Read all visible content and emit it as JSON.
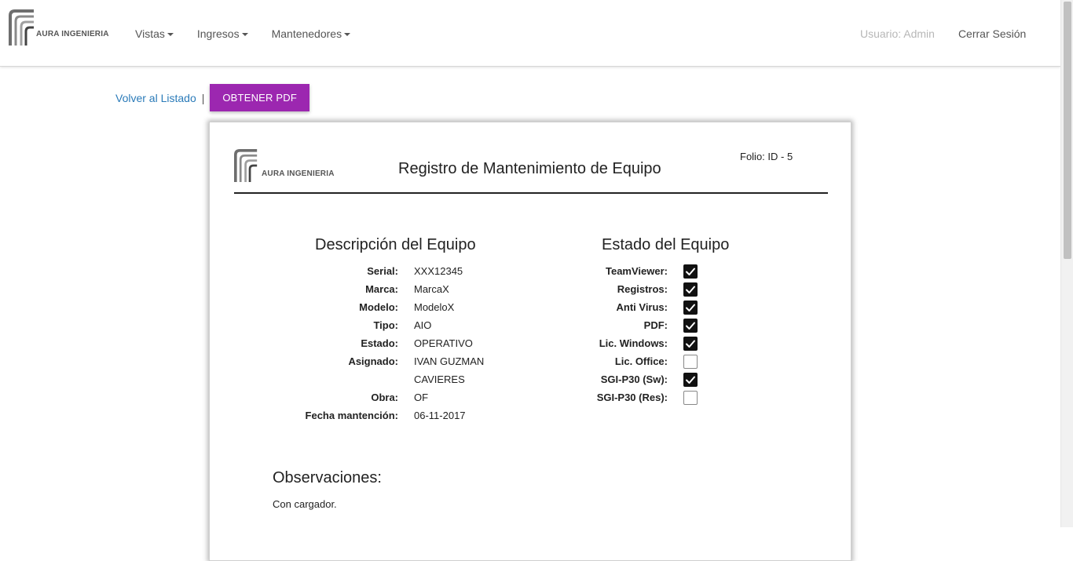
{
  "brand": {
    "name": "AURA INGENIERIA"
  },
  "nav": {
    "items": [
      {
        "label": "Vistas"
      },
      {
        "label": "Ingresos"
      },
      {
        "label": "Mantenedores"
      }
    ],
    "user": "Usuario: Admin",
    "logout": "Cerrar Sesión"
  },
  "actions": {
    "back": "Volver al Listado",
    "separator": "|",
    "pdf": "OBTENER PDF",
    "pdf_color": "#9c27b0"
  },
  "document": {
    "brand": "AURA INGENIERIA",
    "title": "Registro de Mantenimiento de Equipo",
    "folio": "Folio: ID - 5",
    "descripcion": {
      "title": "Descripción del Equipo",
      "rows": [
        {
          "label": "Serial:",
          "value": "XXX12345"
        },
        {
          "label": "Marca:",
          "value": "MarcaX"
        },
        {
          "label": "Modelo:",
          "value": "ModeloX"
        },
        {
          "label": "Tipo:",
          "value": "AIO"
        },
        {
          "label": "Estado:",
          "value": "OPERATIVO"
        },
        {
          "label": "Asignado:",
          "value": "IVAN GUZMAN"
        },
        {
          "label": "",
          "value": "CAVIERES"
        },
        {
          "label": "Obra:",
          "value": "OF"
        },
        {
          "label": "Fecha mantención:",
          "value": "06-11-2017"
        }
      ]
    },
    "estado": {
      "title": "Estado del Equipo",
      "rows": [
        {
          "label": "TeamViewer:",
          "checked": true
        },
        {
          "label": "Registros:",
          "checked": true
        },
        {
          "label": "Anti Virus:",
          "checked": true
        },
        {
          "label": "PDF:",
          "checked": true
        },
        {
          "label": "Lic. Windows:",
          "checked": true
        },
        {
          "label": "Lic. Office:",
          "checked": false
        },
        {
          "label": "SGI-P30 (Sw):",
          "checked": true
        },
        {
          "label": "SGI-P30 (Res):",
          "checked": false
        }
      ]
    },
    "observaciones": {
      "title": "Observaciones:",
      "text": "Con cargador."
    }
  }
}
